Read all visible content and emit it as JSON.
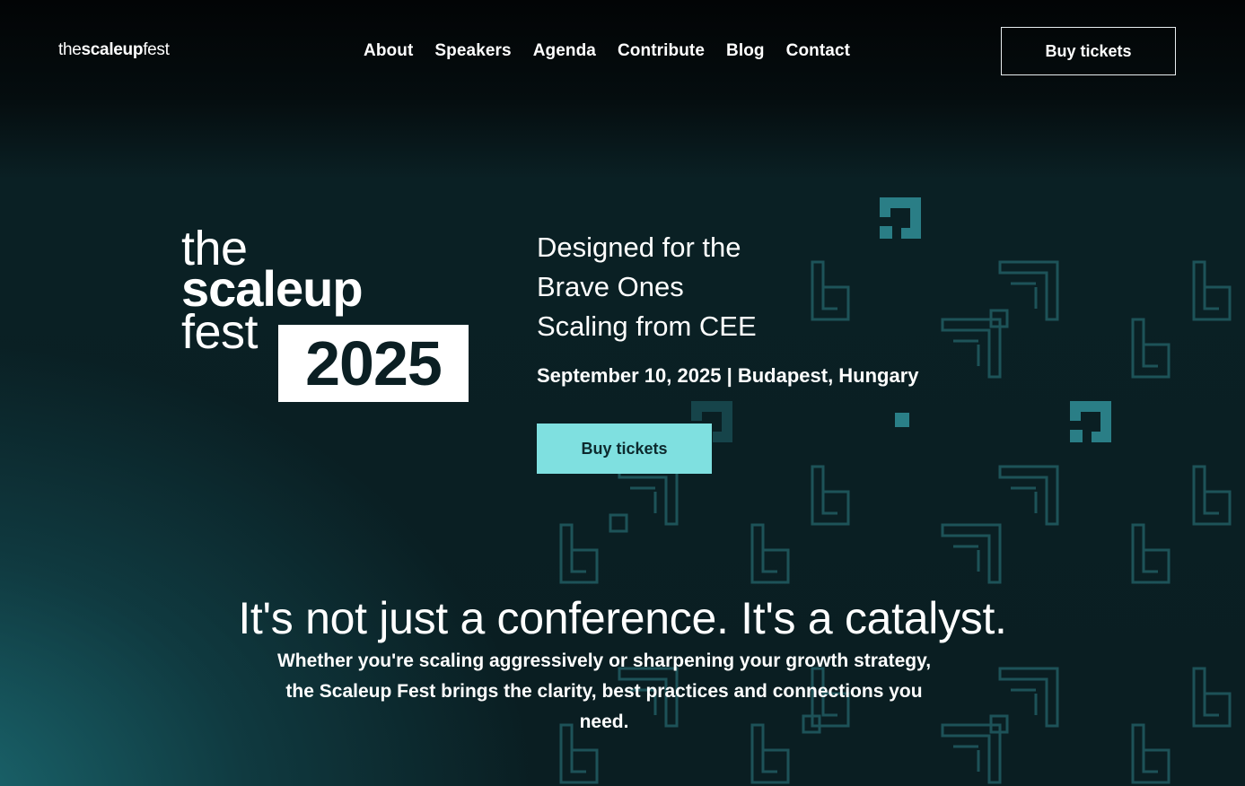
{
  "brand": {
    "prefix": "the",
    "middle": "scaleup",
    "suffix": "fest"
  },
  "nav": {
    "items": [
      "About",
      "Speakers",
      "Agenda",
      "Contribute",
      "Blog",
      "Contact"
    ]
  },
  "header": {
    "cta_label": "Buy tickets"
  },
  "hero": {
    "logo_line1": "the",
    "logo_line2": "scaleup",
    "logo_line3": "fest",
    "logo_year": "2025",
    "tagline": [
      "Designed for the",
      "Brave Ones",
      "Scaling from CEE"
    ],
    "date_location": "September 10, 2025 | Budapest, Hungary",
    "cta_label": "Buy tickets"
  },
  "section": {
    "headline": "It's not just a conference. It's a catalyst.",
    "body": "Whether you're scaling aggressively or sharpening your growth strategy, the Scaleup Fest brings the clarity, best practices and connections you need."
  },
  "colors": {
    "background": "#0a1e22",
    "accent": "#7fe0e0",
    "pattern": "#2a7a82"
  },
  "icons": {
    "pattern": "geometric-corner-glyphs"
  }
}
